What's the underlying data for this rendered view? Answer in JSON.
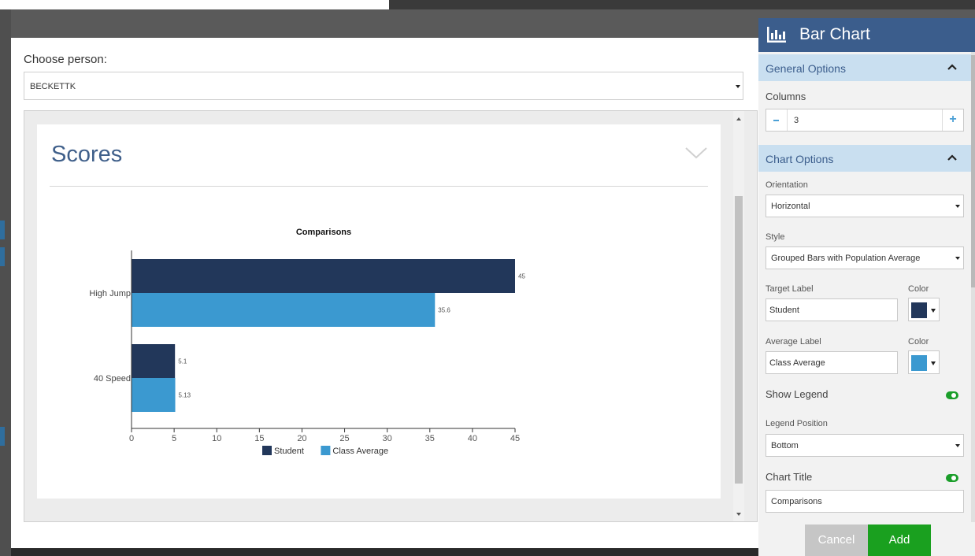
{
  "modal": {
    "choose_label": "Choose person:",
    "person_value": "BECKETTK"
  },
  "card": {
    "title": "Scores"
  },
  "chart_data": {
    "type": "bar",
    "orientation": "horizontal",
    "title": "Comparisons",
    "categories": [
      "High Jump",
      "40 Speed"
    ],
    "series": [
      {
        "name": "Student",
        "values": [
          45,
          5.1
        ],
        "labels": [
          "45",
          "5.1"
        ],
        "color": "#22375a"
      },
      {
        "name": "Class Average",
        "values": [
          35.6,
          5.13
        ],
        "labels": [
          "35.6",
          "5.13"
        ],
        "color": "#3b99d0"
      }
    ],
    "xlim": [
      0,
      45
    ],
    "xticks": [
      "0",
      "5",
      "10",
      "15",
      "20",
      "25",
      "30",
      "35",
      "40",
      "45"
    ],
    "legend_position": "bottom"
  },
  "panel": {
    "title": "Bar Chart",
    "general": {
      "header": "General Options",
      "columns_label": "Columns",
      "columns_value": "3"
    },
    "chart_options": {
      "header": "Chart Options",
      "orientation_label": "Orientation",
      "orientation_value": "Horizontal",
      "style_label": "Style",
      "style_value": "Grouped Bars with Population Average",
      "target_label": "Target Label",
      "target_value": "Student",
      "target_color_label": "Color",
      "target_color": "#22375a",
      "average_label": "Average Label",
      "average_value": "Class Average",
      "average_color_label": "Color",
      "average_color": "#3b99d0",
      "show_legend_label": "Show Legend",
      "legend_position_label": "Legend Position",
      "legend_position_value": "Bottom",
      "chart_title_label": "Chart Title",
      "chart_title_value": "Comparisons"
    },
    "cancel_label": "Cancel",
    "add_label": "Add"
  }
}
